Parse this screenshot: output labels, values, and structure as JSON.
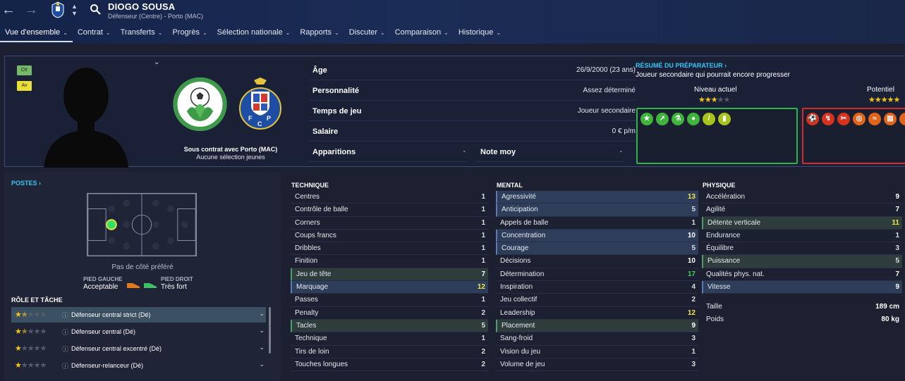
{
  "header": {
    "name": "DIOGO SOUSA",
    "subtitle": "Défenseur (Centre) - Porto (MAC)"
  },
  "menu": [
    {
      "label": "Vue d'ensemble",
      "active": true
    },
    {
      "label": "Contrat"
    },
    {
      "label": "Transferts"
    },
    {
      "label": "Progrès"
    },
    {
      "label": "Sélection nationale"
    },
    {
      "label": "Rapports"
    },
    {
      "label": "Discuter"
    },
    {
      "label": "Comparaison"
    },
    {
      "label": "Historique"
    }
  ],
  "profile": {
    "tags": [
      "Ctr",
      "Av"
    ],
    "contract_line1": "Sous contrat avec Porto (MAC)",
    "contract_line2": "Aucune sélection jeunes",
    "info": {
      "age_label": "Âge",
      "age_value": "26/9/2000 (23 ans)",
      "personality_label": "Personnalité",
      "personality_value": "Assez déterminé",
      "playtime_label": "Temps de jeu",
      "playtime_value": "Joueur secondaire",
      "salary_label": "Salaire",
      "salary_value": "0 € p/m",
      "apps_label": "Apparitions",
      "apps_value": "-",
      "rating_label": "Note moy",
      "rating_value": "-"
    }
  },
  "report": {
    "title": "RÉSUMÉ DU PRÉPARATEUR ›",
    "text": "Joueur secondaire qui pourrait encore progresser",
    "current_label": "Niveau actuel",
    "potential_label": "Potentiel",
    "current_stars": 3,
    "potential_stars": 5,
    "strength_icons": [
      "star-icon",
      "trend-up-icon",
      "flask-icon",
      "brain-icon",
      "boot-icon",
      "vest-icon"
    ],
    "weakness_icons": [
      "ball-icon",
      "dribble-icon",
      "scissors-icon",
      "target-icon",
      "pass-icon",
      "clipboard-icon",
      "players-icon"
    ]
  },
  "positions": {
    "title": "POSTES ›",
    "foot_text": "Pas de côté préféré",
    "left_label": "PIED GAUCHE",
    "left_value": "Acceptable",
    "right_label": "PIED DROIT",
    "right_value": "Très fort"
  },
  "roles": {
    "title": "RÔLE ET TÂCHE",
    "items": [
      {
        "label": "Défenseur central strict (Dé)",
        "stars": 1.5
      },
      {
        "label": "Défenseur central (Dé)",
        "stars": 1.5
      },
      {
        "label": "Défenseur central excentré (Dé)",
        "stars": 1
      },
      {
        "label": "Défenseur-relanceur (Dé)",
        "stars": 1
      }
    ]
  },
  "technique": {
    "title": "TECHNIQUE",
    "rows": [
      {
        "name": "Centres",
        "value": "1"
      },
      {
        "name": "Contrôle de balle",
        "value": "1"
      },
      {
        "name": "Corners",
        "value": "1"
      },
      {
        "name": "Coups francs",
        "value": "1"
      },
      {
        "name": "Dribbles",
        "value": "1"
      },
      {
        "name": "Finition",
        "value": "1"
      },
      {
        "name": "Jeu de tête",
        "value": "7"
      },
      {
        "name": "Marquage",
        "value": "12"
      },
      {
        "name": "Passes",
        "value": "1"
      },
      {
        "name": "Penalty",
        "value": "2"
      },
      {
        "name": "Tacles",
        "value": "5"
      },
      {
        "name": "Technique",
        "value": "1"
      },
      {
        "name": "Tirs de loin",
        "value": "2"
      },
      {
        "name": "Touches longues",
        "value": "2"
      }
    ]
  },
  "mental": {
    "title": "MENTAL",
    "rows": [
      {
        "name": "Agressivité",
        "value": "13"
      },
      {
        "name": "Anticipation",
        "value": "5"
      },
      {
        "name": "Appels de balle",
        "value": "1"
      },
      {
        "name": "Concentration",
        "value": "10"
      },
      {
        "name": "Courage",
        "value": "5"
      },
      {
        "name": "Décisions",
        "value": "10"
      },
      {
        "name": "Détermination",
        "value": "17"
      },
      {
        "name": "Inspiration",
        "value": "4"
      },
      {
        "name": "Jeu collectif",
        "value": "2"
      },
      {
        "name": "Leadership",
        "value": "12"
      },
      {
        "name": "Placement",
        "value": "9"
      },
      {
        "name": "Sang-froid",
        "value": "3"
      },
      {
        "name": "Vision du jeu",
        "value": "1"
      },
      {
        "name": "Volume de jeu",
        "value": "3"
      }
    ]
  },
  "physique": {
    "title": "PHYSIQUE",
    "rows": [
      {
        "name": "Accélération",
        "value": "9"
      },
      {
        "name": "Agilité",
        "value": "7"
      },
      {
        "name": "Détente verticale",
        "value": "11"
      },
      {
        "name": "Endurance",
        "value": "1"
      },
      {
        "name": "Équilibre",
        "value": "3"
      },
      {
        "name": "Puissance",
        "value": "5"
      },
      {
        "name": "Qualités phys. nat.",
        "value": "7"
      },
      {
        "name": "Vitesse",
        "value": "9"
      }
    ],
    "height_label": "Taille",
    "height_value": "189 cm",
    "weight_label": "Poids",
    "weight_value": "80 kg"
  },
  "colors": {
    "accent": "#36c8f4",
    "strength": "#2fb34a",
    "weakness": "#d12d2d",
    "star": "#f5c518"
  }
}
